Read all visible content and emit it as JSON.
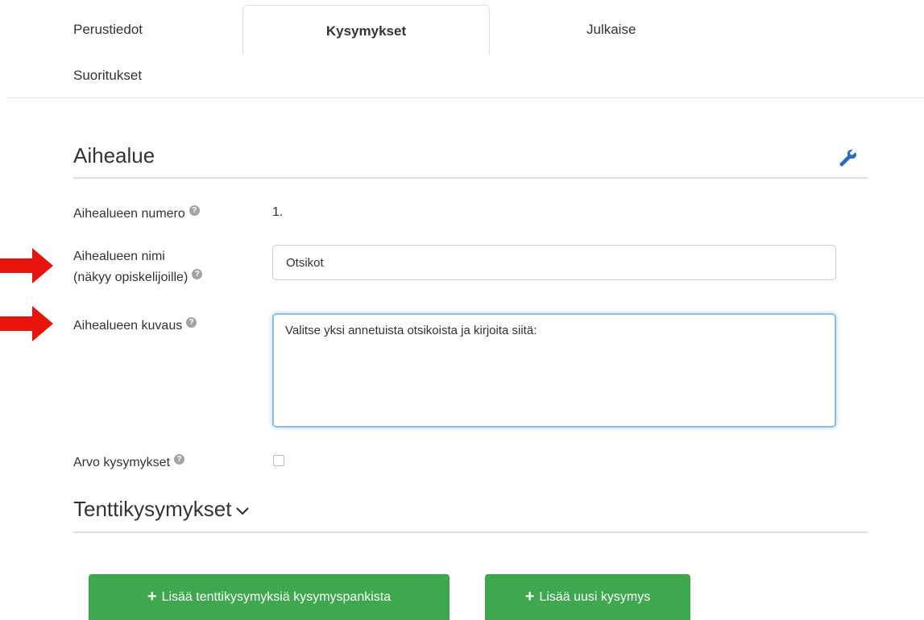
{
  "tabs": {
    "perustiedot": "Perustiedot",
    "kysymykset": "Kysymykset",
    "julkaise": "Julkaise",
    "suoritukset": "Suoritukset"
  },
  "section": {
    "title": "Aihealue",
    "icon": "wrench-icon"
  },
  "form": {
    "number_label": "Aihealueen numero",
    "number_value": "1.",
    "name_label_line1": "Aihealueen nimi",
    "name_label_line2": "(näkyy opiskelijoille)",
    "name_value": "Otsikot",
    "description_label": "Aihealueen kuvaus",
    "description_value": "Valitse yksi annetuista otsikoista ja kirjoita siitä:",
    "randomize_label": "Arvo kysymykset",
    "randomize_checked": false,
    "help_icon": "?"
  },
  "questions": {
    "title": "Tenttikysymykset",
    "add_from_bank": "Lisää tenttikysymyksiä kysymyspankista",
    "add_new": "Lisää uusi kysymys",
    "plus": "+"
  },
  "colors": {
    "accent_green": "#3fa84f",
    "annotation_red": "#e8140c",
    "focus_blue": "#8dbbf0",
    "link_blue": "#2a6bbd"
  }
}
